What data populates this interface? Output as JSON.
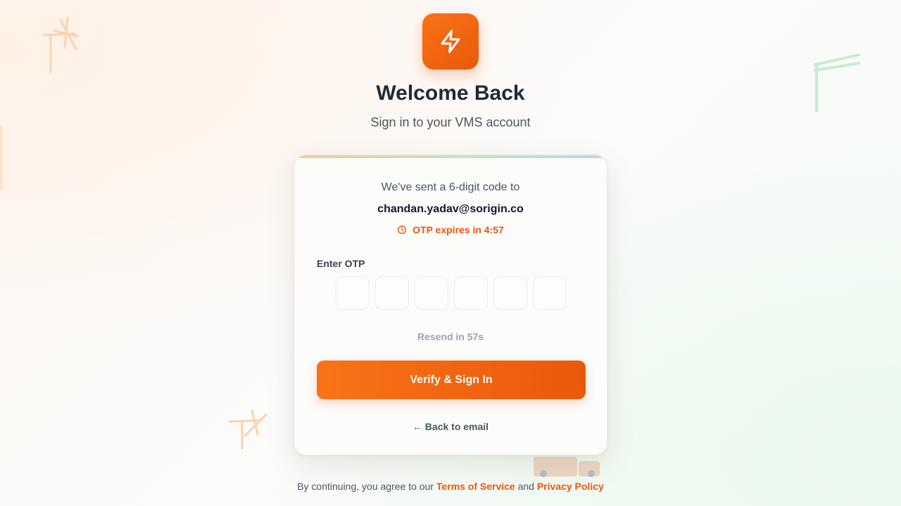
{
  "header": {
    "logo_icon": "lightning-bolt-icon",
    "title": "Welcome Back",
    "subtitle": "Sign in to your VMS account"
  },
  "otp_card": {
    "sent_message": "We've sent a 6-digit code to",
    "email": "chandan.yadav@sorigin.co",
    "expiry_icon": "clock-icon",
    "expiry_text": "OTP expires in 4:57",
    "otp_label": "Enter OTP",
    "otp_digits": [
      "",
      "",
      "",
      "",
      "",
      ""
    ],
    "resend_text": "Resend in 57s",
    "verify_button_label": "Verify & Sign In",
    "back_link_label": "← Back to email"
  },
  "footer": {
    "prefix": "By continuing, you agree to our",
    "terms_label": "Terms of Service",
    "conjunction": "and",
    "privacy_label": "Privacy Policy"
  },
  "colors": {
    "accent": "#ea580c",
    "accent_light": "#f97316",
    "title": "#1f2937",
    "muted": "#9ca3af"
  }
}
